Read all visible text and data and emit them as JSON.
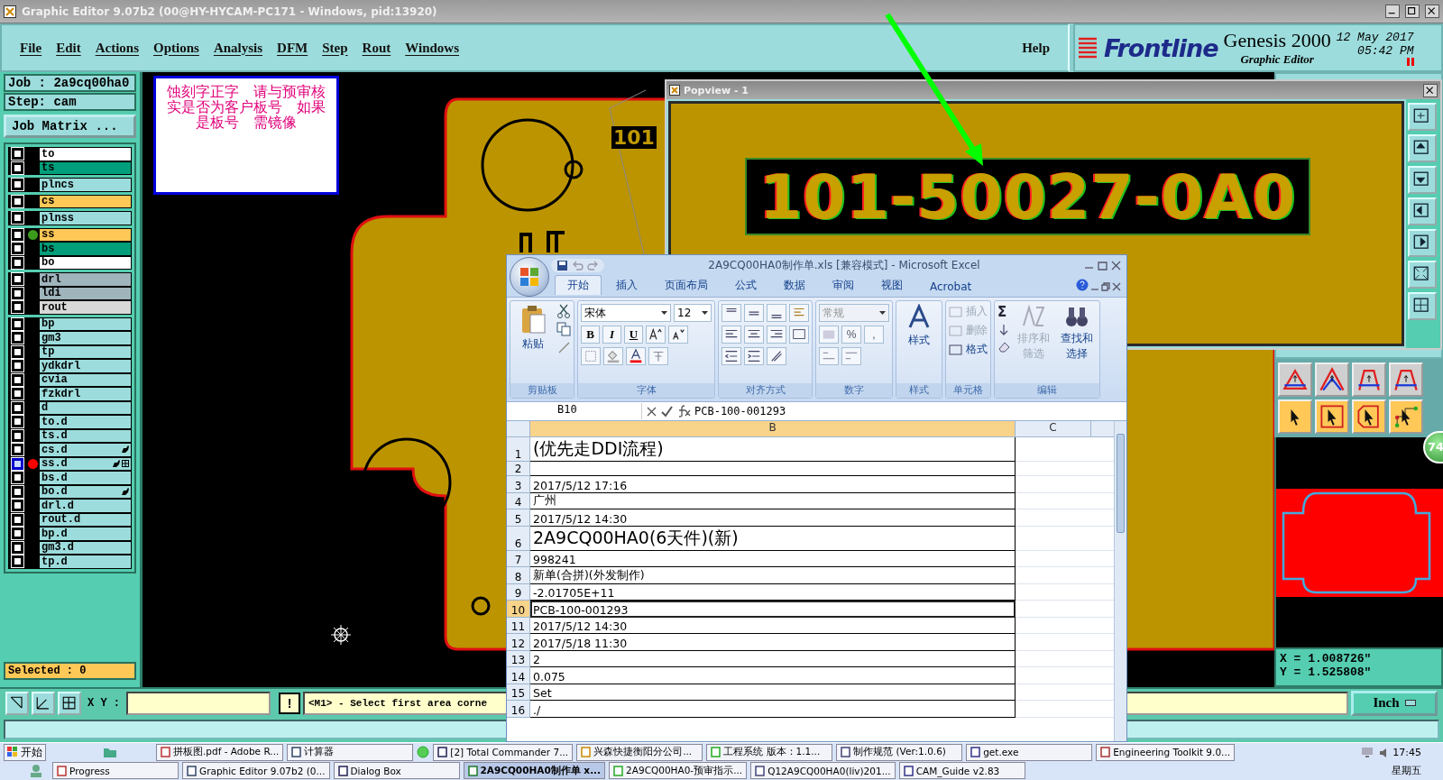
{
  "window": {
    "title": "Graphic Editor 9.07b2 (00@HY-HYCAM-PC171 - Windows, pid:13920)"
  },
  "menu": [
    "File",
    "Edit",
    "Actions",
    "Options",
    "Analysis",
    "DFM",
    "Step",
    "Rout",
    "Windows"
  ],
  "help": "Help",
  "brand": {
    "logo": "Frontline",
    "product": "Genesis 2000",
    "subtitle": "Graphic Editor",
    "date": "12 May 2017",
    "time": "05:42 PM"
  },
  "job": {
    "job": "Job : 2a9cq00ha0",
    "step": "Step: cam",
    "matrix_button": "Job Matrix ..."
  },
  "layer_groups": [
    {
      "layers": [
        {
          "name": "to",
          "color": "#ffffff",
          "active": false
        },
        {
          "name": "ts",
          "color": "#009e7a",
          "active": false
        }
      ]
    },
    {
      "layers": [
        {
          "name": "plncs",
          "color": "#9ddcdc",
          "active": false
        }
      ]
    },
    {
      "layers": [
        {
          "name": "cs",
          "color": "#ffc857",
          "active": false
        }
      ]
    },
    {
      "layers": [
        {
          "name": "plnss",
          "color": "#9ddcdc",
          "active": false
        }
      ]
    },
    {
      "layers": [
        {
          "name": "ss",
          "color": "#ffc857",
          "active": false,
          "dot": {
            "color": "#3c9a1c"
          }
        },
        {
          "name": "bs",
          "color": "#009e7a",
          "active": false
        },
        {
          "name": "bo",
          "color": "#ffffff",
          "active": false
        }
      ]
    },
    {
      "layers": [
        {
          "name": "drl",
          "color": "#a0b4bc",
          "active": false
        },
        {
          "name": "ldi",
          "color": "#a0b4bc",
          "active": false
        },
        {
          "name": "rout",
          "color": "#d8d8d8",
          "active": false
        }
      ]
    },
    {
      "layers": [
        {
          "name": "bp",
          "color": "#9ddcdc",
          "active": false,
          "hand": false,
          "grid": false
        },
        {
          "name": "gm3",
          "color": "#9ddcdc",
          "active": false,
          "hand": false,
          "grid": false
        },
        {
          "name": "tp",
          "color": "#9ddcdc",
          "active": false,
          "hand": false,
          "grid": false
        },
        {
          "name": "ydkdrl",
          "color": "#9ddcdc",
          "active": false,
          "hand": false,
          "grid": false
        },
        {
          "name": "cvia",
          "color": "#9ddcdc",
          "active": false,
          "hand": false,
          "grid": false
        },
        {
          "name": "fzkdrl",
          "color": "#9ddcdc",
          "active": false,
          "hand": false,
          "grid": false
        },
        {
          "name": "d",
          "color": "#9ddcdc",
          "active": false,
          "hand": false,
          "grid": false
        },
        {
          "name": "to.d",
          "color": "#9ddcdc",
          "active": false,
          "hand": false,
          "grid": false
        },
        {
          "name": "ts.d",
          "color": "#9ddcdc",
          "active": false,
          "hand": false,
          "grid": false
        },
        {
          "name": "cs.d",
          "color": "#9ddcdc",
          "active": false,
          "hand": true,
          "grid": false
        },
        {
          "name": "ss.d",
          "color": "#9ddcdc",
          "active": true,
          "dot": {
            "color": "#ff0000"
          },
          "hand": true,
          "grid": true
        },
        {
          "name": "bs.d",
          "color": "#9ddcdc",
          "active": false,
          "hand": false,
          "grid": false
        },
        {
          "name": "bo.d",
          "color": "#9ddcdc",
          "active": false,
          "hand": true,
          "grid": false
        },
        {
          "name": "drl.d",
          "color": "#9ddcdc",
          "active": false,
          "hand": false,
          "grid": false
        },
        {
          "name": "rout.d",
          "color": "#9ddcdc",
          "active": false,
          "hand": false,
          "grid": false
        },
        {
          "name": "bp.d",
          "color": "#9ddcdc",
          "active": false,
          "hand": false,
          "grid": false
        },
        {
          "name": "gm3.d",
          "color": "#9ddcdc",
          "active": false,
          "hand": false,
          "grid": false
        },
        {
          "name": "tp.d",
          "color": "#9ddcdc",
          "active": false,
          "hand": false,
          "grid": false
        }
      ]
    }
  ],
  "selected_count": "Selected : 0",
  "note": {
    "lines": [
      "蚀刻字正字　请与预审核",
      "实是否为客户板号　如果",
      "是板号　需镜像"
    ]
  },
  "board_label": "101",
  "popview": {
    "title": "Popview - 1",
    "text": "101-50027-0A0"
  },
  "command": {
    "xy_label": "X Y :",
    "bang": "!",
    "message": "<M1> - Select first area corne",
    "units": "Inch"
  },
  "coords": {
    "x": "X = 1.008726\"",
    "y": "Y = 1.525808\""
  },
  "badge": "74",
  "excel": {
    "title": "2A9CQ00HA0制作单.xls  [兼容模式] - Microsoft Excel",
    "tabs": [
      {
        "label": "开始",
        "selected": true
      },
      {
        "label": "插入",
        "selected": false
      },
      {
        "label": "页面布局",
        "selected": false
      },
      {
        "label": "公式",
        "selected": false
      },
      {
        "label": "数据",
        "selected": false
      },
      {
        "label": "审阅",
        "selected": false
      },
      {
        "label": "视图",
        "selected": false
      },
      {
        "label": "Acrobat",
        "selected": false
      }
    ],
    "groups": [
      {
        "kind": "clipboard",
        "label": "剪贴板",
        "big": "粘贴"
      },
      {
        "kind": "font",
        "label": "字体",
        "font": "宋体",
        "size": "12",
        "styles": [
          "B",
          "I",
          "U"
        ]
      },
      {
        "kind": "align",
        "label": "对齐方式"
      },
      {
        "kind": "number",
        "label": "数字",
        "format": "常规",
        "symbols": [
          "%",
          ","
        ]
      },
      {
        "kind": "styles",
        "label": "样式",
        "big": "样式"
      },
      {
        "kind": "cells",
        "label": "单元格",
        "commands": [
          {
            "label": "插入",
            "disabled": true
          },
          {
            "label": "删除",
            "disabled": true
          },
          {
            "label": "格式",
            "disabled": false
          }
        ]
      },
      {
        "kind": "editing",
        "label": "编辑",
        "sum": "Σ",
        "commands": [
          {
            "label": "排序和筛选",
            "disabled": true
          },
          {
            "label": "查找和选择",
            "disabled": false
          }
        ]
      }
    ],
    "name_box": "B10",
    "formula": "PCB-100-001293",
    "columns": [
      "B",
      "C"
    ],
    "rows": [
      {
        "number": "1",
        "value": "(优先走DDI流程)",
        "large": true,
        "selected": false
      },
      {
        "number": "2",
        "large": false,
        "selected": false
      },
      {
        "number": "3",
        "value": "2017/5/12 17:16",
        "large": false,
        "selected": false
      },
      {
        "number": "4",
        "value": "广州",
        "large": false,
        "selected": false
      },
      {
        "number": "5",
        "value": "2017/5/12 14:30",
        "large": false,
        "selected": false
      },
      {
        "number": "6",
        "value": "2A9CQ00HA0(6天件)(新)",
        "large": true,
        "selected": false
      },
      {
        "number": "7",
        "value": "998241",
        "large": false,
        "selected": false
      },
      {
        "number": "8",
        "value": "新单(合拼)(外发制作)",
        "large": false,
        "selected": false
      },
      {
        "number": "9",
        "value": "-2.01705E+11",
        "large": false,
        "selected": false
      },
      {
        "number": "10",
        "value": "PCB-100-001293",
        "large": false,
        "selected": true
      },
      {
        "number": "11",
        "value": "2017/5/12 14:30",
        "large": false,
        "selected": false
      },
      {
        "number": "12",
        "value": "2017/5/18 11:30",
        "large": false,
        "selected": false
      },
      {
        "number": "13",
        "value": "2",
        "large": false,
        "selected": false
      },
      {
        "number": "14",
        "value": "0.075",
        "large": false,
        "selected": false
      },
      {
        "number": "15",
        "value": "Set",
        "large": false,
        "selected": false
      },
      {
        "number": "16",
        "value": "./",
        "large": false,
        "selected": false
      }
    ]
  },
  "taskbar": {
    "start": "开始",
    "rows": [
      {
        "items": [
          {
            "label": "拼板图.pdf - Adobe R...",
            "selected": false
          },
          {
            "label": "计算器",
            "selected": false
          },
          {
            "label": "[2] Total Commander 7...",
            "selected": false
          },
          {
            "label": "兴森快捷衡阳分公司...",
            "selected": false
          },
          {
            "label": "工程系统  版本：1.1...",
            "selected": false
          },
          {
            "label": "制作规范 (Ver:1.0.6)",
            "selected": false
          },
          {
            "label": "get.exe",
            "selected": false
          },
          {
            "label": "Engineering Toolkit 9.0...",
            "selected": false
          }
        ]
      },
      {
        "items": [
          {
            "label": "Progress",
            "selected": false
          },
          {
            "label": "Graphic Editor 9.07b2 (0...",
            "selected": false
          },
          {
            "label": "Dialog Box",
            "selected": false
          },
          {
            "label": "2A9CQ00HA0制作单 x...",
            "selected": true
          },
          {
            "label": "2A9CQ00HA0-预审指示...",
            "selected": false
          },
          {
            "label": "Q12A9CQ00HA0(liv)201...",
            "selected": false
          },
          {
            "label": "CAM_Guide v2.83",
            "selected": false
          }
        ]
      }
    ],
    "time": "17:45",
    "day": "星期五"
  }
}
